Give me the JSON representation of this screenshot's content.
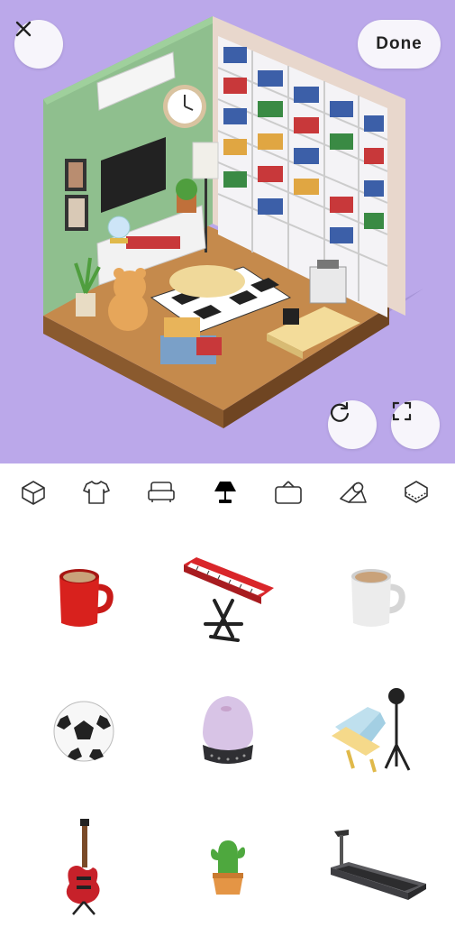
{
  "toolbar": {
    "done_label": "Done"
  },
  "icons": {
    "close": "close-icon",
    "rotate": "rotate-icon",
    "fullscreen": "fullscreen-icon"
  },
  "tabs": [
    {
      "id": "room",
      "icon": "cube-icon",
      "active": false
    },
    {
      "id": "wallpaper",
      "icon": "shirt-icon",
      "active": false
    },
    {
      "id": "furniture",
      "icon": "sofa-icon",
      "active": false
    },
    {
      "id": "lamps",
      "icon": "lamp-icon",
      "active": true
    },
    {
      "id": "wall-decor",
      "icon": "frame-icon",
      "active": false
    },
    {
      "id": "floor",
      "icon": "rug-icon",
      "active": false
    },
    {
      "id": "other",
      "icon": "layers-icon",
      "active": false
    }
  ],
  "items": [
    {
      "name": "red-mug",
      "icon": "red-mug-icon"
    },
    {
      "name": "keyboard-synth",
      "icon": "keyboard-icon"
    },
    {
      "name": "white-mug",
      "icon": "white-mug-icon"
    },
    {
      "name": "soccer-ball",
      "icon": "soccer-ball-icon"
    },
    {
      "name": "egg-lamp",
      "icon": "egg-lamp-icon"
    },
    {
      "name": "photo-studio-chair",
      "icon": "studio-chair-icon"
    },
    {
      "name": "electric-guitar",
      "icon": "guitar-icon"
    },
    {
      "name": "cactus-plant",
      "icon": "cactus-icon"
    },
    {
      "name": "treadmill",
      "icon": "treadmill-icon"
    }
  ],
  "colors": {
    "scene_bg": "#bba8ea",
    "accent_active": "#000000"
  }
}
